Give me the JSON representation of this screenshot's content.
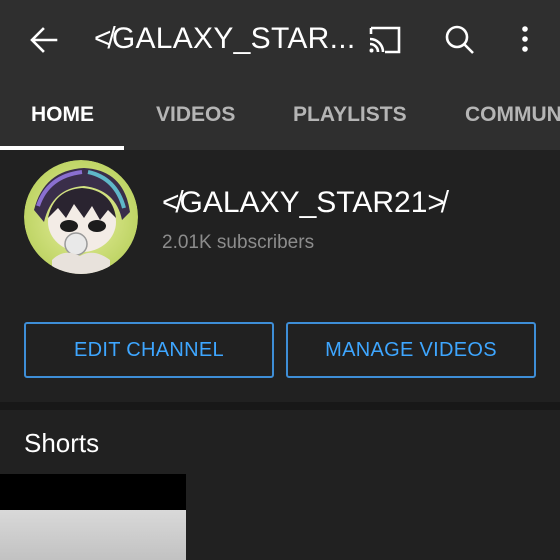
{
  "appbar": {
    "title": "≮GALAXY_STAR...",
    "icons": [
      "back-arrow-icon",
      "cast-icon",
      "search-icon",
      "more-vert-icon"
    ]
  },
  "tabs": [
    {
      "label": "HOME",
      "active": true
    },
    {
      "label": "VIDEOS",
      "active": false
    },
    {
      "label": "PLAYLISTS",
      "active": false
    },
    {
      "label": "COMMUN",
      "active": false
    }
  ],
  "channel": {
    "name": "≮GALAXY_STAR21≯",
    "subscribers": "2.01K subscribers"
  },
  "buttons": {
    "edit_channel": "EDIT CHANNEL",
    "manage_videos": "MANAGE VIDEOS"
  },
  "shorts": {
    "title": "Shorts"
  },
  "colors": {
    "appbar_bg": "#2f2f2f",
    "header_bg": "#212121",
    "accent": "#3ea6ff",
    "secondary_text": "#8c8c8c"
  }
}
